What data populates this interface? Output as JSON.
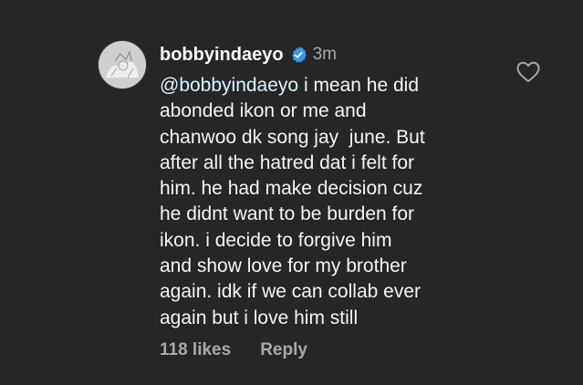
{
  "comment": {
    "username": "bobbyindaeyo",
    "verified_icon": "verified-badge-icon",
    "time": "3m",
    "mention": "@bobbyindaeyo",
    "first_line_rest": " i mean he did",
    "lines": [
      "abonded ikon or me and",
      "chanwoo dk song jay  june. But",
      "after all the hatred dat i felt for",
      "him. he had make decision cuz",
      "he didnt want to be burden for",
      "ikon. i decide to forgive him",
      "and show love for my brother",
      "again. idk if we can collab ever",
      "again but i love him still"
    ],
    "likes": "118 likes",
    "reply_label": "Reply",
    "like_icon": "heart-outline-icon"
  },
  "colors": {
    "background": "#262626",
    "text": "#f5f5f5",
    "muted": "#a8a8a8",
    "verified_blue": "#3897f0"
  }
}
